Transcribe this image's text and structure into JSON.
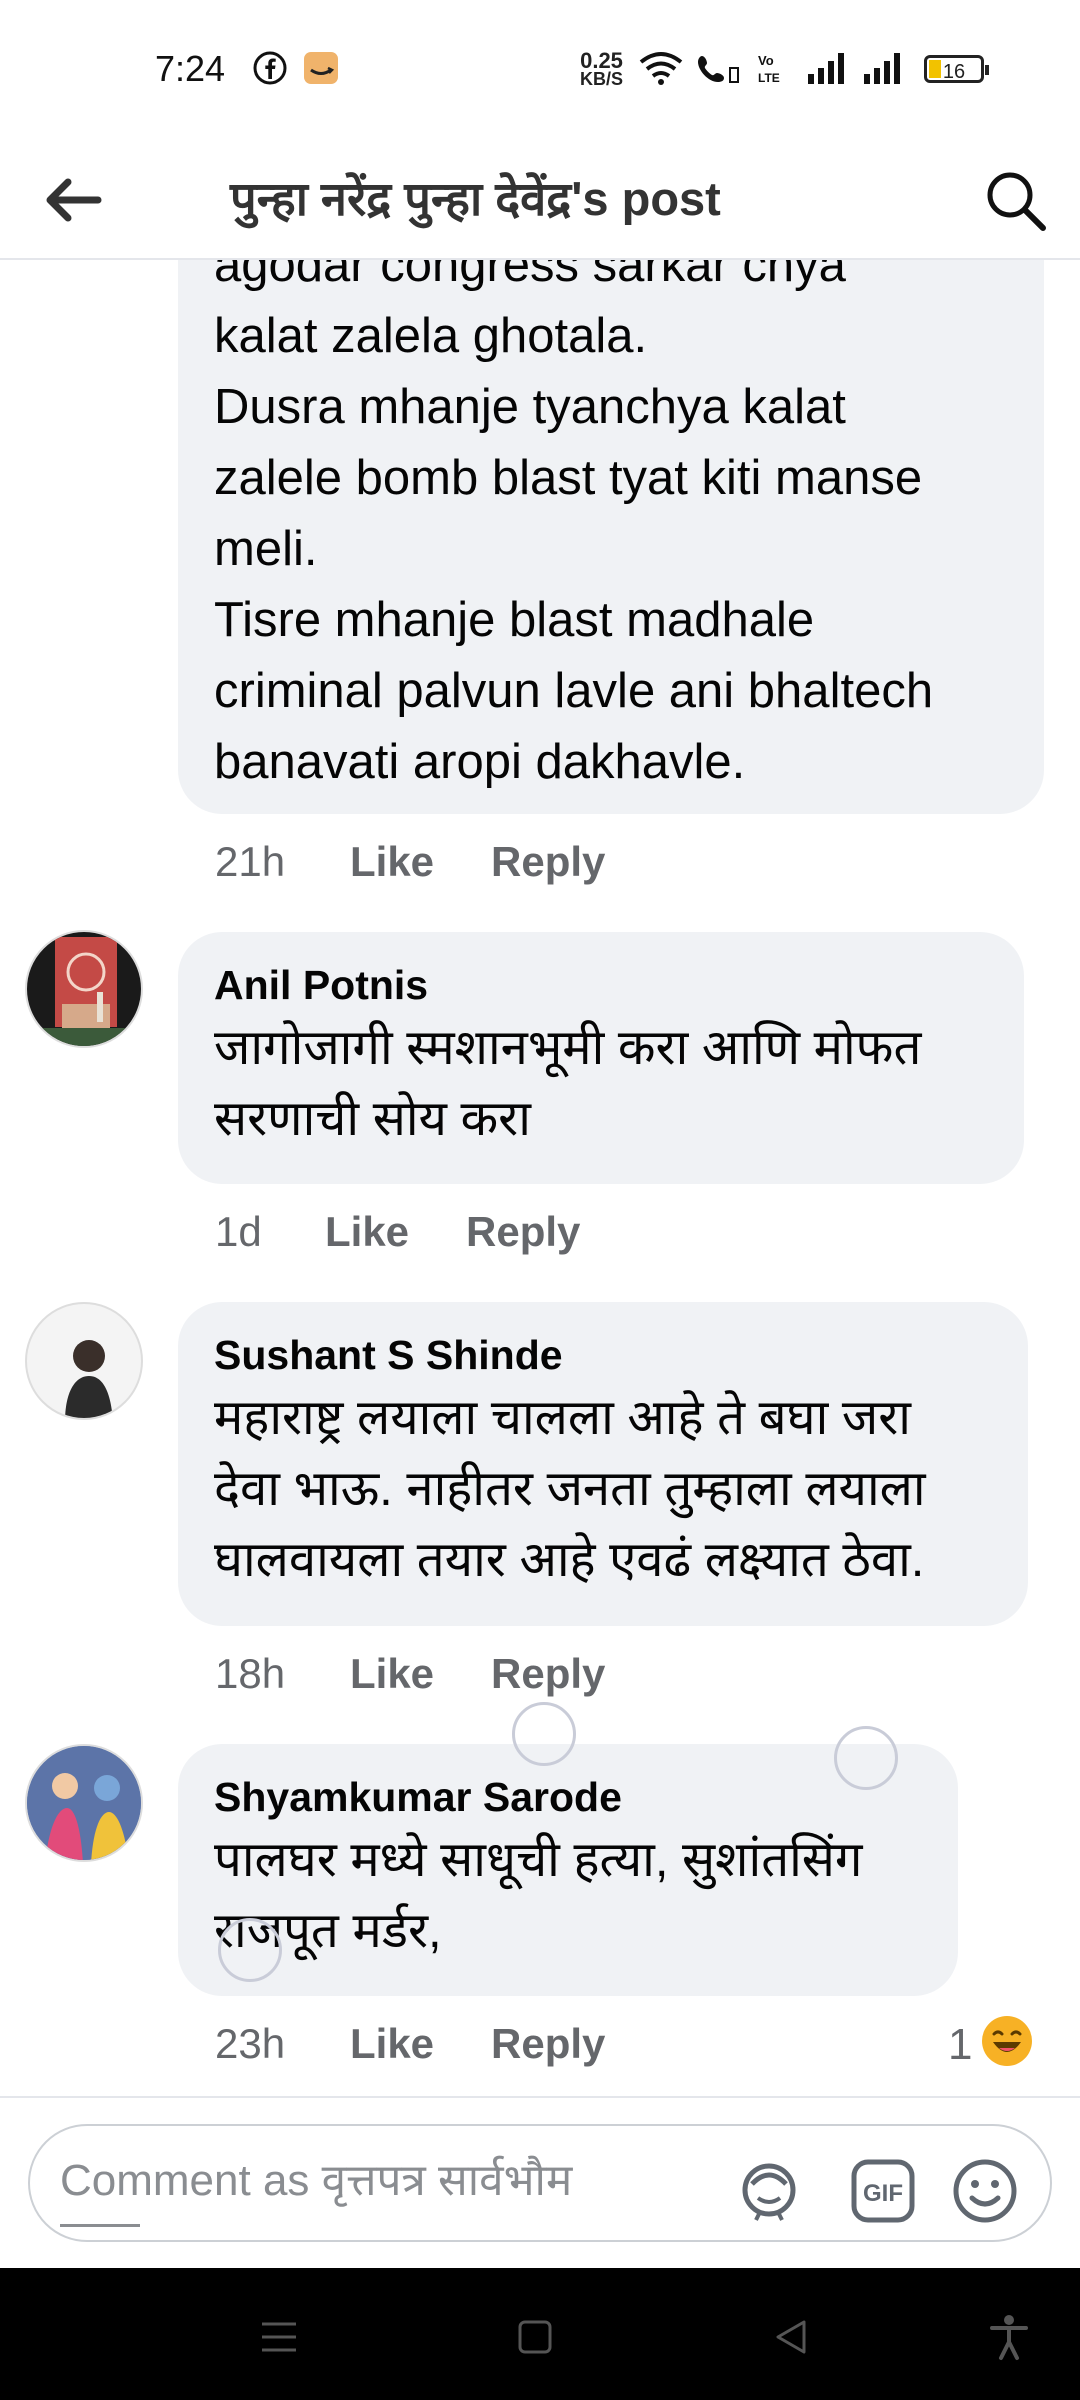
{
  "status_bar": {
    "time": "7:24",
    "net_speed_value": "0.25",
    "net_speed_unit": "KB/S",
    "battery": "16",
    "icons": [
      "facebook-icon",
      "amazon-icon",
      "wifi-icon",
      "volte-call-icon",
      "signal-icon",
      "signal-icon",
      "battery-icon"
    ]
  },
  "header": {
    "title": "पुन्हा नरेंद्र पुन्हा देवेंद्र's post",
    "back_icon": "back-arrow-icon",
    "search_icon": "search-icon"
  },
  "comments": [
    {
      "author": "",
      "text": "agodar congress sarkar chya\nkalat zalela ghotala.\nDusra mhanje tyanchya kalat\nzalele bomb blast tyat kiti manse\nmeli.\nTisre mhanje blast madhale\ncriminal palvun lavle ani bhaltech\nbanavati aropi dakhavle.",
      "time": "21h",
      "like": "Like",
      "reply": "Reply"
    },
    {
      "author": "Anil Potnis",
      "text": "जागोजागी स्मशानभूमी करा आणि मोफत\nसरणाची सोय करा",
      "time": "1d",
      "like": "Like",
      "reply": "Reply"
    },
    {
      "author": "Sushant S Shinde",
      "text": "महाराष्ट्र लयाला चालला आहे ते बघा जरा\nदेवा भाऊ. नाहीतर जनता तुम्हाला लयाला\nघालवायला तयार आहे एवढं लक्ष्यात ठेवा.",
      "time": "18h",
      "like": "Like",
      "reply": "Reply"
    },
    {
      "author": "Shyamkumar Sarode",
      "text": "पालघर मध्ये साधूची हत्या, सुशांतसिंग\nराजपूत मर्डर,",
      "time": "23h",
      "like": "Like",
      "reply": "Reply",
      "reaction_count": "1",
      "reaction_icon": "haha-emoji-icon"
    }
  ],
  "composer": {
    "placeholder": "Comment as वृत्तपत्र सार्वभौम",
    "icons": [
      "avatar-sticker-icon",
      "gif-icon",
      "emoji-icon"
    ]
  },
  "nav_bar": {
    "icons": [
      "menu-icon",
      "home-square-icon",
      "back-triangle-icon",
      "accessibility-icon"
    ]
  }
}
